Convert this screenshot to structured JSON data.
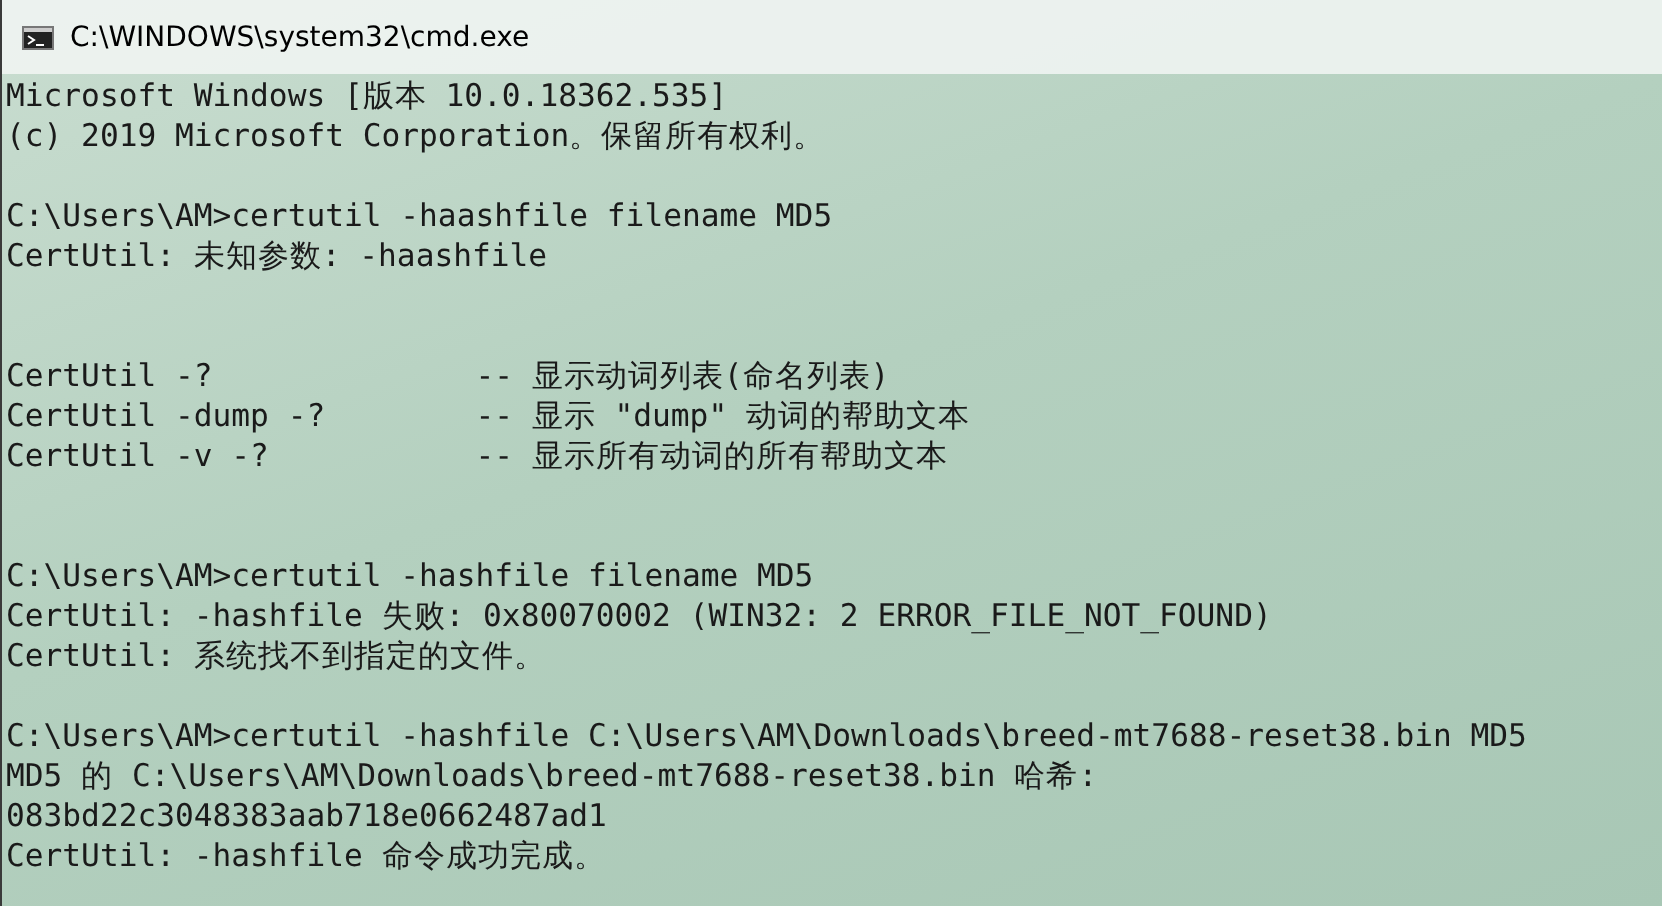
{
  "window": {
    "title": "C:\\WINDOWS\\system32\\cmd.exe"
  },
  "console": {
    "blocks": [
      {
        "kind": "output",
        "lines": [
          "Microsoft Windows [版本 10.0.18362.535]",
          "(c) 2019 Microsoft Corporation。保留所有权利。"
        ]
      },
      {
        "kind": "output",
        "lines": [
          "C:\\Users\\AM>certutil -haashfile filename MD5",
          "CertUtil: 未知参数: -haashfile"
        ]
      },
      {
        "kind": "help",
        "lines": [
          "CertUtil -?              -- 显示动词列表(命名列表)",
          "CertUtil -dump -?        -- 显示 \"dump\" 动词的帮助文本",
          "CertUtil -v -?           -- 显示所有动词的所有帮助文本"
        ]
      },
      {
        "kind": "output",
        "lines": [
          "C:\\Users\\AM>certutil -hashfile filename MD5",
          "CertUtil: -hashfile 失败: 0x80070002 (WIN32: 2 ERROR_FILE_NOT_FOUND)",
          "CertUtil: 系统找不到指定的文件。"
        ]
      },
      {
        "kind": "output",
        "lines": [
          "C:\\Users\\AM>certutil -hashfile C:\\Users\\AM\\Downloads\\breed-mt7688-reset38.bin MD5",
          "MD5 的 C:\\Users\\AM\\Downloads\\breed-mt7688-reset38.bin 哈希:",
          "083bd22c3048383aab718e0662487ad1",
          "CertUtil: -hashfile 命令成功完成。"
        ]
      }
    ]
  }
}
